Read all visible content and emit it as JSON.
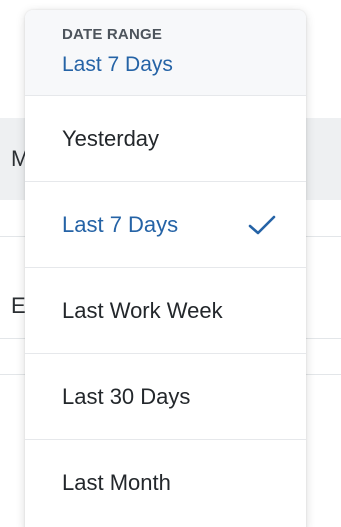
{
  "background": {
    "glyph_1": "M",
    "glyph_2": "E"
  },
  "dropdown": {
    "header_label": "DATE RANGE",
    "header_value": "Last 7 Days",
    "items": [
      {
        "label": "Yesterday",
        "selected": false
      },
      {
        "label": "Last 7 Days",
        "selected": true
      },
      {
        "label": "Last Work Week",
        "selected": false
      },
      {
        "label": "Last 30 Days",
        "selected": false
      },
      {
        "label": "Last Month",
        "selected": false
      }
    ],
    "selected_icon": "checkmark-icon"
  },
  "colors": {
    "accent": "#2563a6",
    "text": "#23272b",
    "header_background": "#f7f8fa"
  }
}
